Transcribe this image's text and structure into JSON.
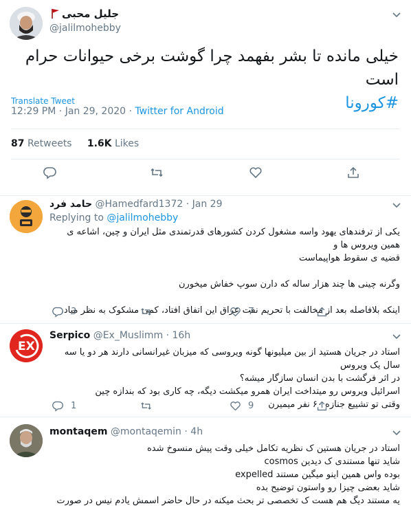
{
  "main_tweet": {
    "display_name": "جلیل محبی",
    "handle": "@jalilmohebby",
    "text": "خیلی مانده تا بشر بفهمد چرا گوشت برخی حیوانات حرام است",
    "hashtag": "#کورونا",
    "translate_label": "Translate Tweet",
    "time": "12:29 PM",
    "date": "Jan 29, 2020",
    "source": "Twitter for Android",
    "retweets_count": "87",
    "retweets_label": "Retweets",
    "likes_count": "1.6K",
    "likes_label": "Likes"
  },
  "replies": [
    {
      "display_name": "حامد فرد",
      "handle": "@Hamedfard1372",
      "date": "Jan 29",
      "replying_prefix": "Replying to",
      "replying_to": "@jalilmohebby",
      "lines": [
        "یکی از ترفندهای یهود واسه مشغول کردن کشورهای قدرتمندی مثل ایران و چین، اشاعه ی همین ویروس ها و",
        "قضیه ی سقوط هواپیماست",
        "",
        "وگرنه چینی ها چند هزار ساله که دارن سوپ خفاش میخورن",
        "",
        "اینکه بلافاصله بعد از مخالفت با تحریم نفت عراق این اتفاق افتاد، کمی مشکوک به نظر میاد."
      ],
      "reply_count": "3",
      "retweet_count": "",
      "like_count": "7"
    },
    {
      "display_name": "Serpico",
      "handle": "@Ex_Muslimm",
      "date": "16h",
      "lines": [
        "استاد در جریان هستید از بین میلیونها گونه ویروسی که میزبان غیرانسانی دارند هر دو یا سه سال یک ویروس",
        "در اثر فرگشت با بدن انسان سازگار میشه؟",
        "اسرائیل ویروس رو میتداخت ایران همرو میکشت دیگه، چه کاری بود که بندازه چین",
        "وقتی تو تشییع جنازه ۶۰ نفر میمیرن"
      ],
      "reply_count": "1",
      "retweet_count": "",
      "like_count": "9"
    },
    {
      "display_name": "montaqem",
      "handle": "@montaqemin",
      "date": "4h",
      "lines": [
        "استاد در جریان هستین ک نظریه تکامل خیلی وقت پیش منسوخ شده",
        "شاید تنها مستندی ک دیدین cosmos",
        "بوده واس همین اینو میگین مستند expelled",
        "شاید بعضی چیزا رو واستون توضیح بده",
        "یه مستند دیگ هم هست ک تخصصی تر بحث میکنه در حال حاضر اسمش یادم نیس در صورت تمایل پیام بدین"
      ]
    }
  ],
  "colors": {
    "accent": "#1b95e0",
    "muted": "#657786",
    "divider": "#e6ecf0",
    "serpico_red": "#e0261f"
  },
  "icons": [
    "reply-icon",
    "retweet-icon",
    "like-icon",
    "share-icon",
    "chevron-down-icon",
    "flag-icon"
  ]
}
